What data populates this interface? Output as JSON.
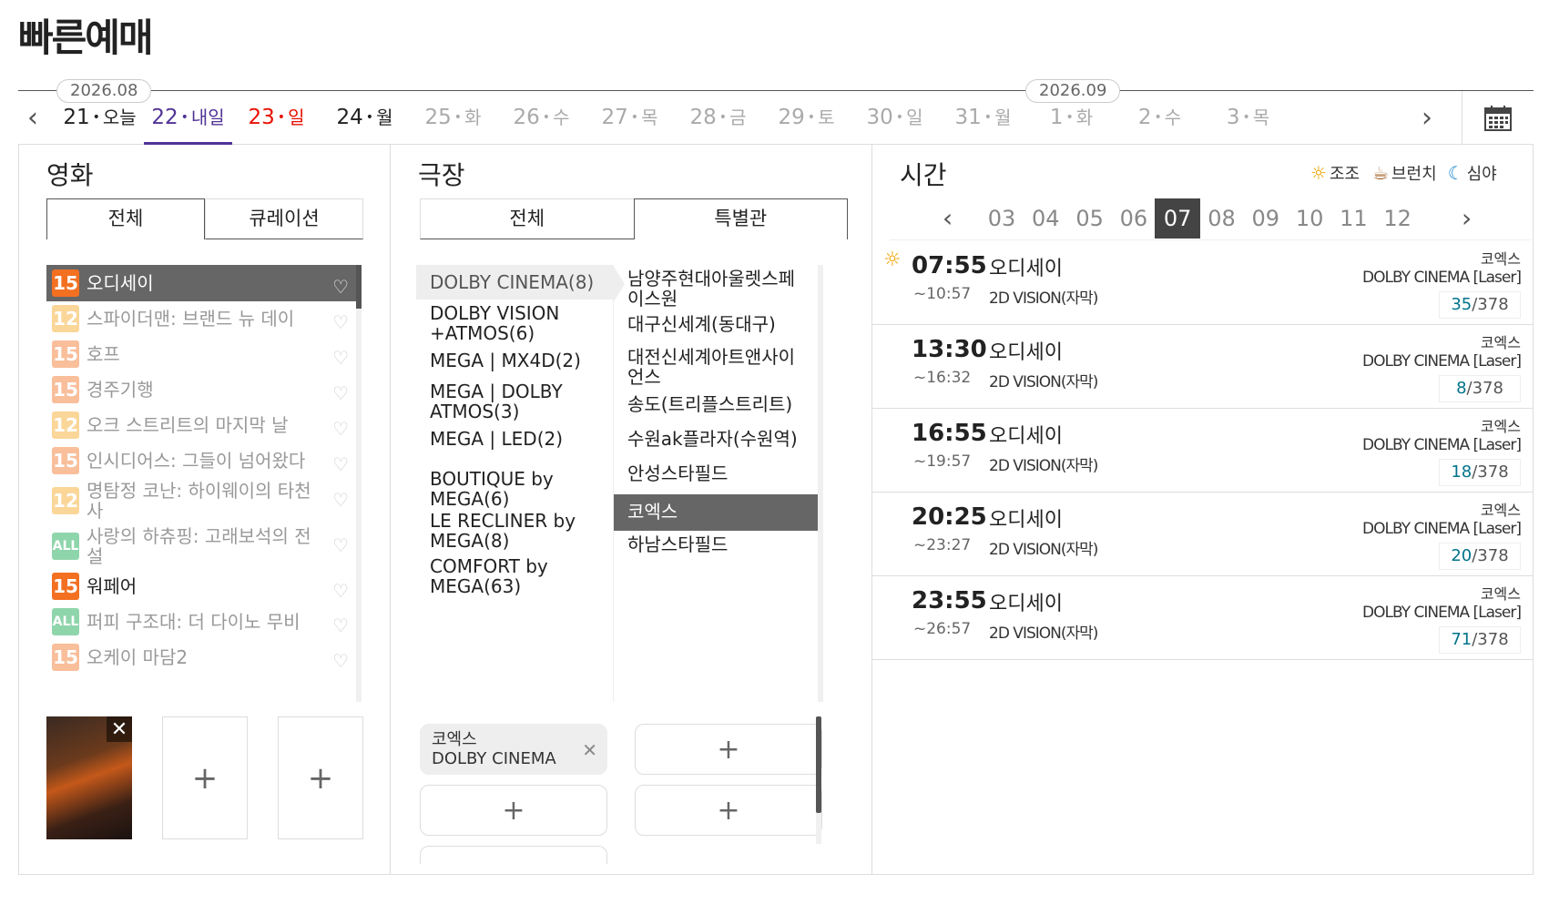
{
  "page": {
    "title": "빠른예매"
  },
  "dates": {
    "month_badges": [
      "2026.08",
      "2026.09"
    ],
    "items": [
      {
        "day": "21",
        "dow": "오늘",
        "state": "normal"
      },
      {
        "day": "22",
        "dow": "내일",
        "state": "selected"
      },
      {
        "day": "23",
        "dow": "일",
        "state": "sunday"
      },
      {
        "day": "24",
        "dow": "월",
        "state": "normal"
      },
      {
        "day": "25",
        "dow": "화",
        "state": "disabled"
      },
      {
        "day": "26",
        "dow": "수",
        "state": "disabled"
      },
      {
        "day": "27",
        "dow": "목",
        "state": "disabled"
      },
      {
        "day": "28",
        "dow": "금",
        "state": "disabled"
      },
      {
        "day": "29",
        "dow": "토",
        "state": "disabled"
      },
      {
        "day": "30",
        "dow": "일",
        "state": "disabled"
      },
      {
        "day": "31",
        "dow": "월",
        "state": "disabled"
      },
      {
        "day": "1",
        "dow": "화",
        "state": "disabled"
      },
      {
        "day": "2",
        "dow": "수",
        "state": "disabled"
      },
      {
        "day": "3",
        "dow": "목",
        "state": "disabled"
      }
    ],
    "dot": "•"
  },
  "movie": {
    "title": "영화",
    "tabs": [
      "전체",
      "큐레이션"
    ],
    "items": [
      {
        "rating": "15",
        "title": "오디세이",
        "state": "selected"
      },
      {
        "rating": "12",
        "title": "스파이더맨: 브랜드 뉴 데이",
        "state": "dim"
      },
      {
        "rating": "15",
        "title": "호프",
        "state": "dim"
      },
      {
        "rating": "15",
        "title": "경주기행",
        "state": "dim"
      },
      {
        "rating": "12",
        "title": "오크 스트리트의 마지막 날",
        "state": "dim"
      },
      {
        "rating": "15",
        "title": "인시디어스: 그들이 넘어왔다",
        "state": "dim"
      },
      {
        "rating": "12",
        "title": "명탐정 코난: 하이웨이의 타천사",
        "state": "dim"
      },
      {
        "rating": "ALL",
        "title": "사랑의 하츄핑: 고래보석의 전설",
        "state": "dim"
      },
      {
        "rating": "15",
        "title": "워페어",
        "state": "normal"
      },
      {
        "rating": "ALL",
        "title": "퍼피 구조대: 더 다이노 무비",
        "state": "dim"
      },
      {
        "rating": "15",
        "title": "오케이 마담2",
        "state": "dim"
      }
    ],
    "heart_icon": "♡",
    "plus": "+",
    "close": "✕"
  },
  "theater": {
    "title": "극장",
    "tabs": [
      "전체",
      "특별관"
    ],
    "brands": [
      "DOLBY CINEMA(8)",
      "DOLBY VISION +ATMOS(6)",
      "MEGA | MX4D(2)",
      "MEGA | DOLBY ATMOS(3)",
      "MEGA | LED(2)",
      "BOUTIQUE by MEGA(6)",
      "LE RECLINER by MEGA(8)",
      "COMFORT by MEGA(63)"
    ],
    "areas": [
      "남양주현대아울렛스페이스원",
      "대구신세계(동대구)",
      "대전신세계아트앤사이언스",
      "송도(트리플스트리트)",
      "수원ak플라자(수원역)",
      "안성스타필드",
      "코엑스",
      "하남스타필드"
    ],
    "selected": {
      "name": "코엑스",
      "brand": "DOLBY CINEMA"
    },
    "plus": "+",
    "close": "✕"
  },
  "time": {
    "title": "시간",
    "legend": [
      {
        "icon": "sun-icon",
        "label": "조조"
      },
      {
        "icon": "coffee-icon",
        "label": "브런치"
      },
      {
        "icon": "moon-icon",
        "label": "심야"
      }
    ],
    "hours": [
      "03",
      "04",
      "05",
      "06",
      "07",
      "08",
      "09",
      "10",
      "11",
      "12"
    ],
    "selected_hour": "07",
    "showtimes": [
      {
        "start": "07:55",
        "end": "~10:57",
        "movie": "오디세이",
        "format": "2D VISION(자막)",
        "theater": "코엑스",
        "hall": "DOLBY CINEMA [Laser]",
        "available": "35",
        "total": "/378",
        "morning": true
      },
      {
        "start": "13:30",
        "end": "~16:32",
        "movie": "오디세이",
        "format": "2D VISION(자막)",
        "theater": "코엑스",
        "hall": "DOLBY CINEMA [Laser]",
        "available": "8",
        "total": "/378",
        "morning": false
      },
      {
        "start": "16:55",
        "end": "~19:57",
        "movie": "오디세이",
        "format": "2D VISION(자막)",
        "theater": "코엑스",
        "hall": "DOLBY CINEMA [Laser]",
        "available": "18",
        "total": "/378",
        "morning": false
      },
      {
        "start": "20:25",
        "end": "~23:27",
        "movie": "오디세이",
        "format": "2D VISION(자막)",
        "theater": "코엑스",
        "hall": "DOLBY CINEMA [Laser]",
        "available": "20",
        "total": "/378",
        "morning": false
      },
      {
        "start": "23:55",
        "end": "~26:57",
        "movie": "오디세이",
        "format": "2D VISION(자막)",
        "theater": "코엑스",
        "hall": "DOLBY CINEMA [Laser]",
        "available": "71",
        "total": "/378",
        "morning": false
      }
    ]
  },
  "colors": {
    "accent": "#503396",
    "sunday": "#e81002",
    "rating15": "#f37021",
    "rating12": "#f8a61e",
    "ratingAll": "#0aa34a",
    "seats": "#01738b"
  }
}
